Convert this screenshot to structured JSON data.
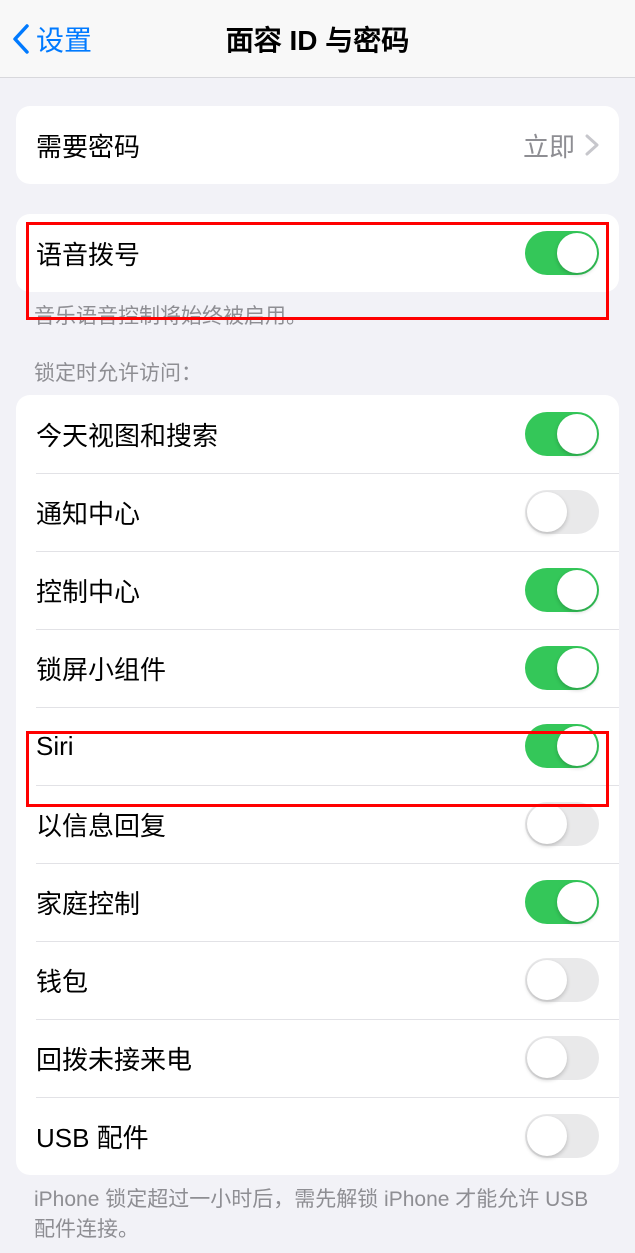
{
  "header": {
    "back_label": "设置",
    "title": "面容 ID 与密码"
  },
  "passcode_row": {
    "label": "需要密码",
    "value": "立即"
  },
  "voice_dial": {
    "label": "语音拨号",
    "on": true,
    "footer": "音乐语音控制将始终被启用。"
  },
  "locked_section": {
    "header": "锁定时允许访问：",
    "items": [
      {
        "label": "今天视图和搜索",
        "on": true
      },
      {
        "label": "通知中心",
        "on": false
      },
      {
        "label": "控制中心",
        "on": true
      },
      {
        "label": "锁屏小组件",
        "on": true
      },
      {
        "label": "Siri",
        "on": true
      },
      {
        "label": "以信息回复",
        "on": false
      },
      {
        "label": "家庭控制",
        "on": true
      },
      {
        "label": "钱包",
        "on": false
      },
      {
        "label": "回拨未接来电",
        "on": false
      },
      {
        "label": "USB 配件",
        "on": false
      }
    ],
    "footer": "iPhone 锁定超过一小时后，需先解锁 iPhone 才能允许 USB 配件连接。"
  }
}
